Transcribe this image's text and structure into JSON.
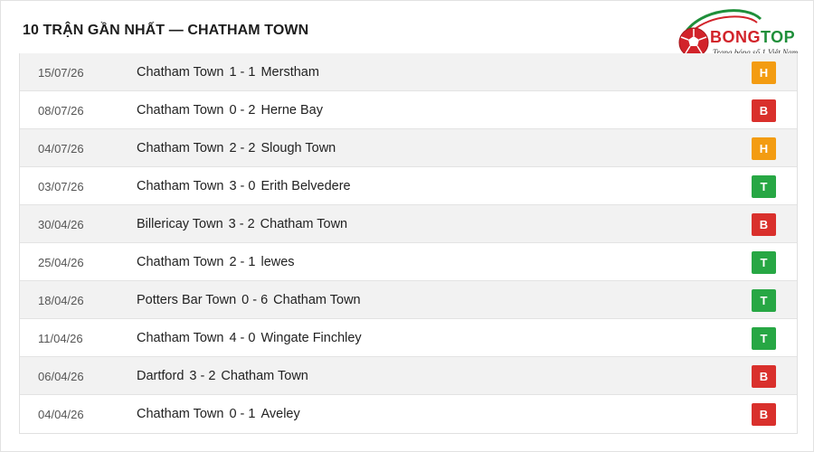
{
  "page": {
    "title": "10 TRẬN GẦN NHẤT — CHATHAM TOWN"
  },
  "logo": {
    "word_part1": "BONG",
    "word_part2": "TOP",
    "tagline": "Trang bóng số 1 Việt Nam",
    "icon": "soccer-ball-icon"
  },
  "colors": {
    "H": "#f39c12",
    "B": "#d9302c",
    "T": "#27a744"
  },
  "matches": [
    {
      "date": "15/07/26",
      "home": "Chatham Town",
      "score": "1 - 1",
      "away": "Merstham",
      "result": "H"
    },
    {
      "date": "08/07/26",
      "home": "Chatham Town",
      "score": "0 - 2",
      "away": "Herne Bay",
      "result": "B"
    },
    {
      "date": "04/07/26",
      "home": "Chatham Town",
      "score": "2 - 2",
      "away": "Slough Town",
      "result": "H"
    },
    {
      "date": "03/07/26",
      "home": "Chatham Town",
      "score": "3 - 0",
      "away": "Erith Belvedere",
      "result": "T"
    },
    {
      "date": "30/04/26",
      "home": "Billericay Town",
      "score": "3 - 2",
      "away": "Chatham Town",
      "result": "B"
    },
    {
      "date": "25/04/26",
      "home": "Chatham Town",
      "score": "2 - 1",
      "away": "lewes",
      "result": "T"
    },
    {
      "date": "18/04/26",
      "home": "Potters Bar Town",
      "score": "0 - 6",
      "away": "Chatham Town",
      "result": "T"
    },
    {
      "date": "11/04/26",
      "home": "Chatham Town",
      "score": "4 - 0",
      "away": "Wingate Finchley",
      "result": "T"
    },
    {
      "date": "06/04/26",
      "home": "Dartford",
      "score": "3 - 2",
      "away": "Chatham Town",
      "result": "B"
    },
    {
      "date": "04/04/26",
      "home": "Chatham Town",
      "score": "0 - 1",
      "away": "Aveley",
      "result": "B"
    }
  ]
}
